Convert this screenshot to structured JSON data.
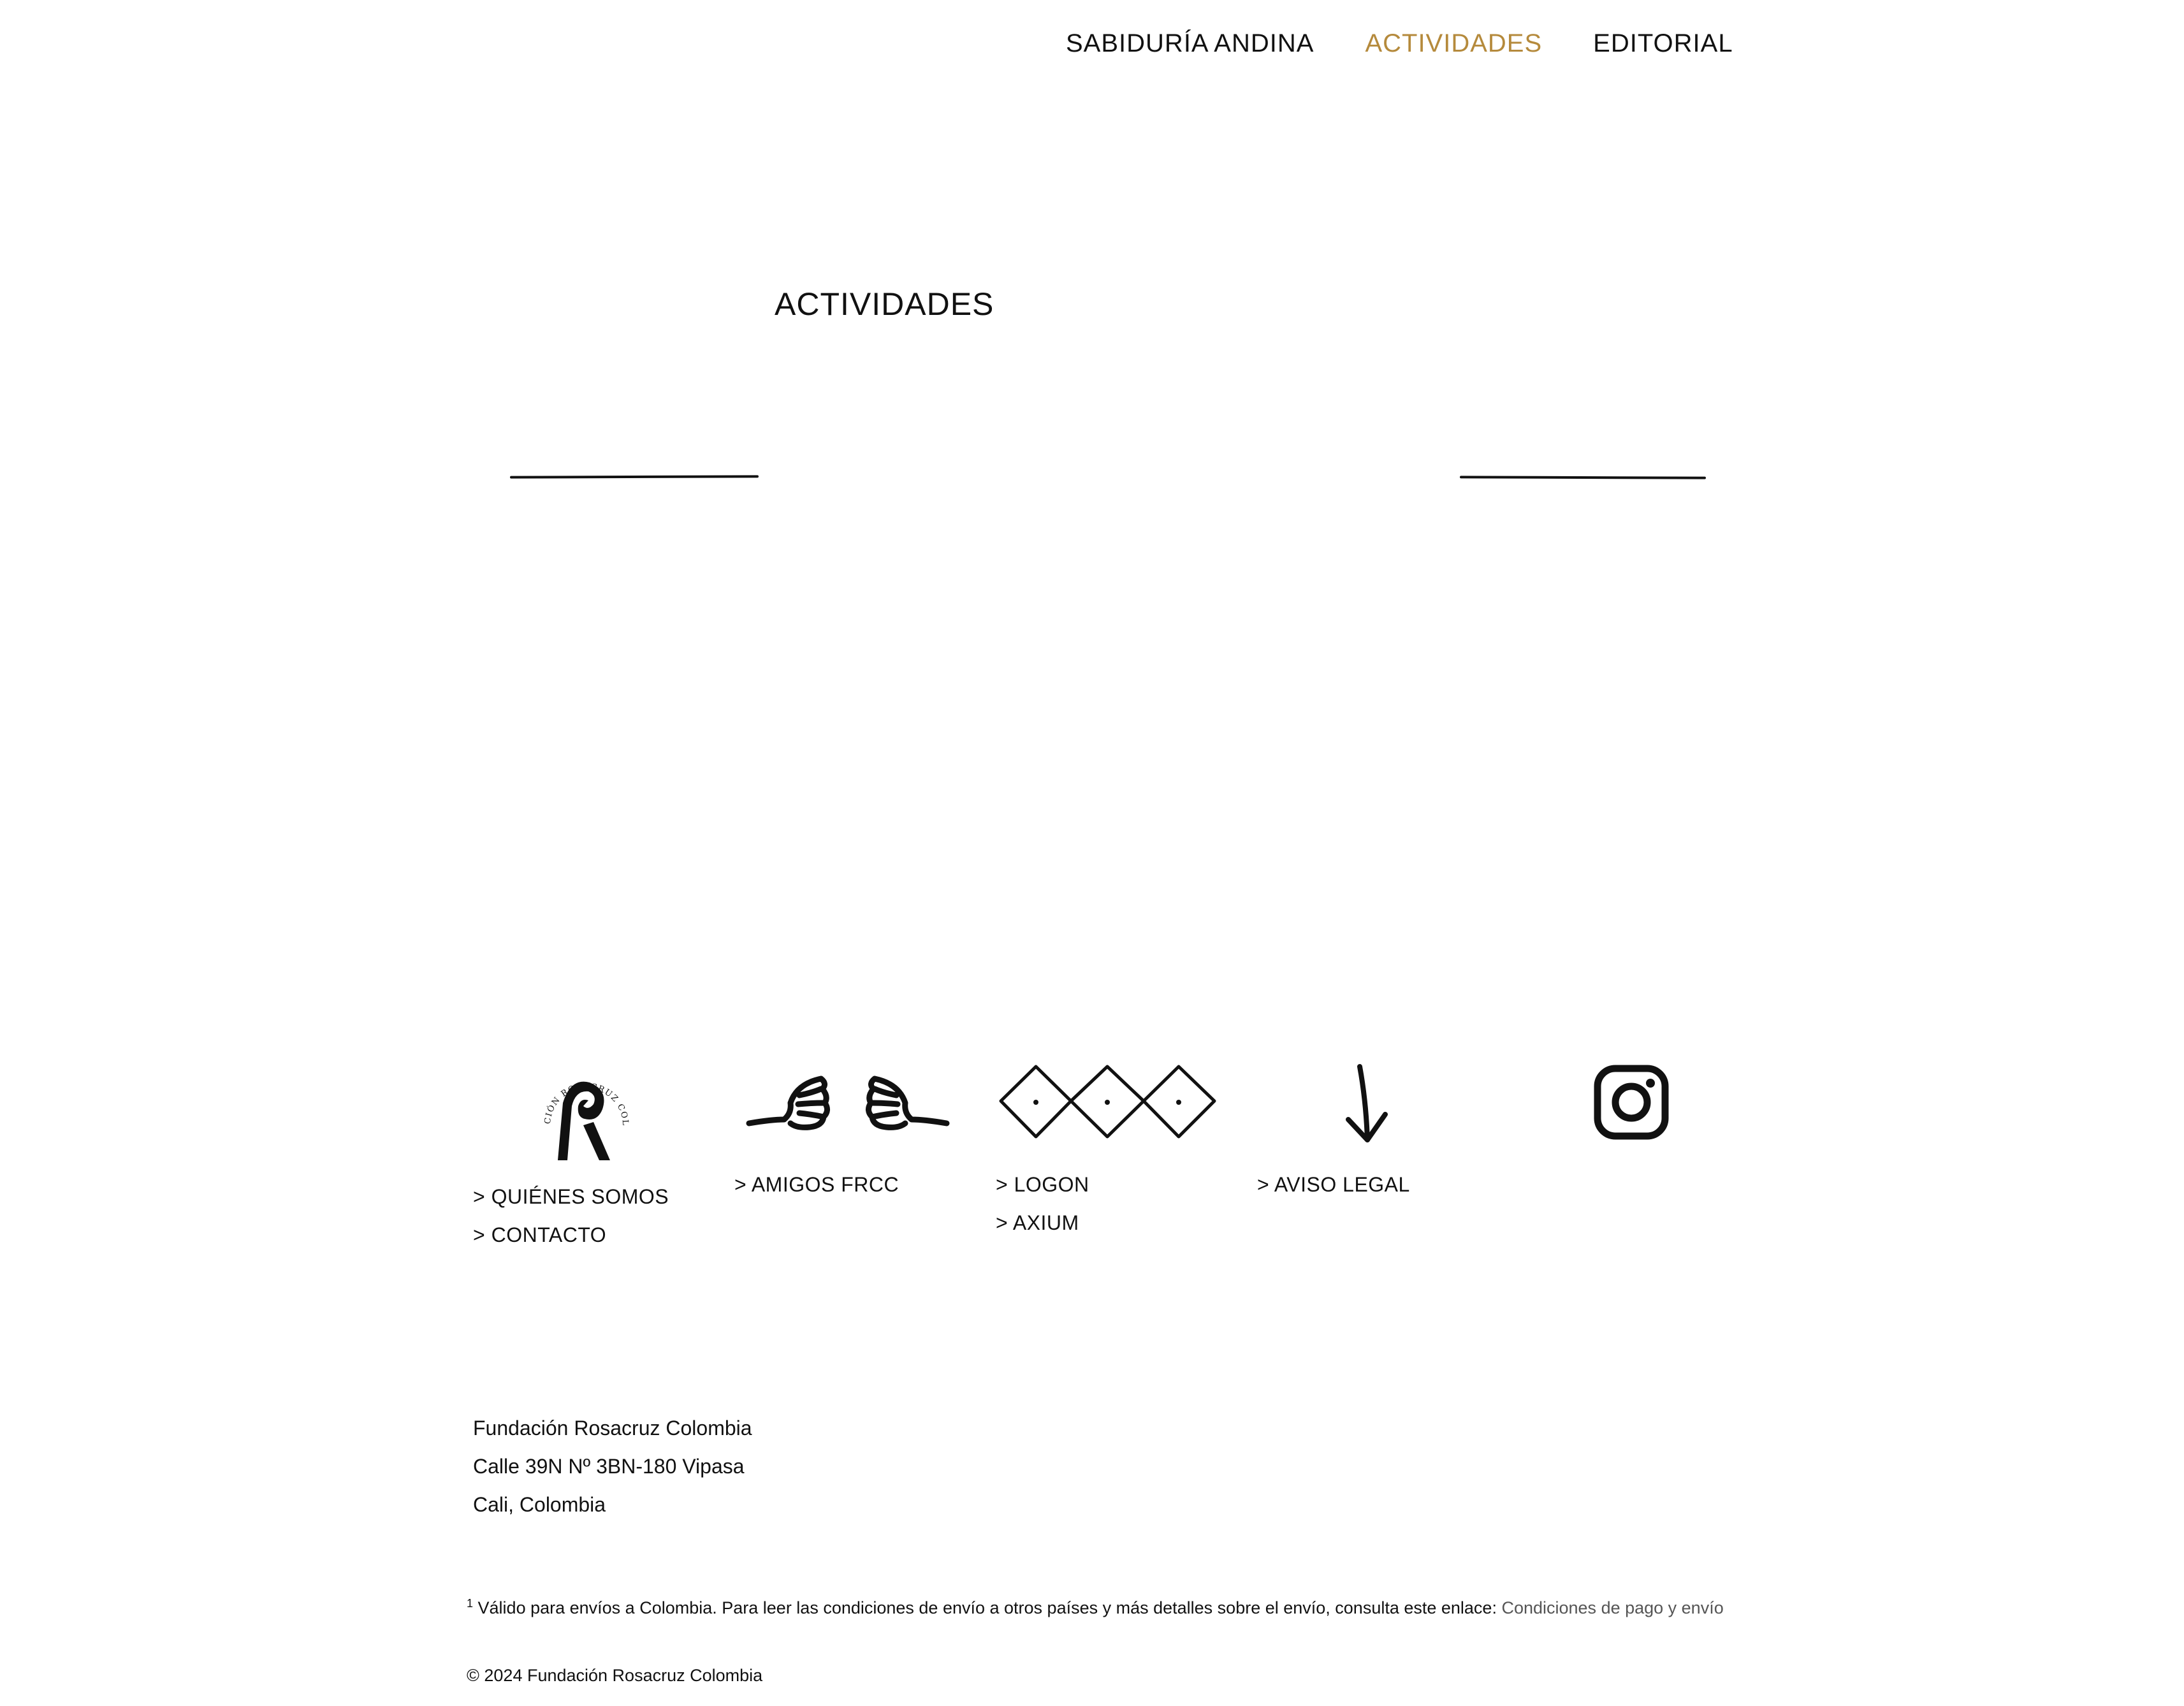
{
  "nav": {
    "items": [
      {
        "label": "SABIDURÍA ANDINA"
      },
      {
        "label": "ACTIVIDADES"
      },
      {
        "label": "EDITORIAL"
      }
    ],
    "active_color": "#b58a3c"
  },
  "page": {
    "title": "ACTIVIDADES"
  },
  "footer": {
    "logo_text": "FUNDACIÓN ROSACRUZ COLOMBIA",
    "links": {
      "quienes_somos": "> QUIÉNES SOMOS",
      "contacto": "> CONTACTO",
      "amigos": "> AMIGOS FRCC",
      "logon": "> LOGON",
      "axium": "> AXIUM",
      "aviso_legal": "> AVISO LEGAL"
    },
    "icons": [
      "rosacruz-logo",
      "hands-icon",
      "diamonds-icon",
      "arrow-down-icon",
      "instagram-icon"
    ],
    "address": {
      "line1": "Fundación Rosacruz Colombia",
      "line2": "Calle 39N Nº 3BN-180 Vipasa",
      "line3": "Cali, Colombia"
    },
    "note": {
      "sup": "1",
      "text": "Válido para envíos a Colombia. Para leer las condiciones de envío a otros países y más detalles sobre el envío, consulta este enlace:",
      "link": "Condiciones de pago y envío"
    },
    "copyright": "© 2024 Fundación Rosacruz Colombia"
  }
}
